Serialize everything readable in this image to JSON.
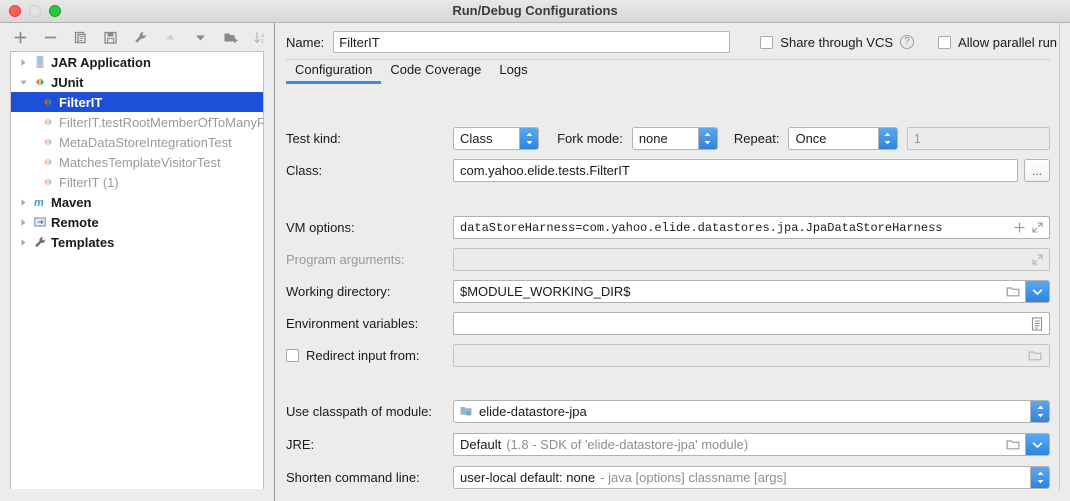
{
  "window": {
    "title": "Run/Debug Configurations"
  },
  "toolbar": {
    "buttons": [
      {
        "name": "add-configuration-button",
        "icon": "plus-icon",
        "enabled": true
      },
      {
        "name": "remove-configuration-button",
        "icon": "minus-icon",
        "enabled": true
      },
      {
        "name": "copy-configuration-button",
        "icon": "copy-icon",
        "enabled": true
      },
      {
        "name": "save-configuration-button",
        "icon": "save-icon",
        "enabled": true
      },
      {
        "name": "edit-templates-button",
        "icon": "wrench-icon",
        "enabled": true
      },
      {
        "name": "move-up-button",
        "icon": "arrow-up-icon",
        "enabled": false
      },
      {
        "name": "move-down-button",
        "icon": "arrow-down-icon",
        "enabled": true
      },
      {
        "name": "create-folder-button",
        "icon": "folder-add-icon",
        "enabled": true
      },
      {
        "name": "sort-configurations-button",
        "icon": "sort-az-icon",
        "enabled": true
      }
    ]
  },
  "tree": {
    "nodes": [
      {
        "label": "JAR Application",
        "depth": 1,
        "twisty": "collapsed",
        "icon": "jar-icon",
        "bold": true,
        "selected": false,
        "dim": false
      },
      {
        "label": "JUnit",
        "depth": 1,
        "twisty": "expanded",
        "icon": "junit-icon",
        "bold": true,
        "selected": false,
        "dim": false
      },
      {
        "label": "FilterIT",
        "depth": 2,
        "twisty": "none",
        "icon": "junit-icon",
        "bold": true,
        "selected": true,
        "dim": false
      },
      {
        "label": "FilterIT.testRootMemberOfToManyR",
        "depth": 2,
        "twisty": "none",
        "icon": "junit-icon",
        "bold": false,
        "selected": false,
        "dim": true
      },
      {
        "label": "MetaDataStoreIntegrationTest",
        "depth": 2,
        "twisty": "none",
        "icon": "junit-icon",
        "bold": false,
        "selected": false,
        "dim": true
      },
      {
        "label": "MatchesTemplateVisitorTest",
        "depth": 2,
        "twisty": "none",
        "icon": "junit-icon",
        "bold": false,
        "selected": false,
        "dim": true
      },
      {
        "label": "FilterIT (1)",
        "depth": 2,
        "twisty": "none",
        "icon": "junit-icon",
        "bold": false,
        "selected": false,
        "dim": true
      },
      {
        "label": "Maven",
        "depth": 1,
        "twisty": "collapsed",
        "icon": "maven-icon",
        "bold": true,
        "selected": false,
        "dim": false
      },
      {
        "label": "Remote",
        "depth": 1,
        "twisty": "collapsed",
        "icon": "remote-icon",
        "bold": true,
        "selected": false,
        "dim": false
      },
      {
        "label": "Templates",
        "depth": 1,
        "twisty": "collapsed",
        "icon": "wrench-icon",
        "bold": true,
        "selected": false,
        "dim": false
      }
    ]
  },
  "header": {
    "name_label": "Name:",
    "name_value": "FilterIT",
    "share_vcs_label": "Share through VCS",
    "share_vcs_checked": false,
    "help_glyph": "?",
    "allow_parallel_label": "Allow parallel run",
    "allow_parallel_checked": false
  },
  "tabs": [
    {
      "label": "Configuration",
      "active": true
    },
    {
      "label": "Code Coverage",
      "active": false
    },
    {
      "label": "Logs",
      "active": false
    }
  ],
  "form": {
    "test_kind_label": "Test kind:",
    "test_kind_value": "Class",
    "fork_mode_label": "Fork mode:",
    "fork_mode_value": "none",
    "repeat_label": "Repeat:",
    "repeat_value": "Once",
    "repeat_count_value": "1",
    "class_label": "Class:",
    "class_value": "com.yahoo.elide.tests.FilterIT",
    "class_browse_label": "...",
    "vm_options_label": "VM options:",
    "vm_options_value": "dataStoreHarness=com.yahoo.elide.datastores.jpa.JpaDataStoreHarness",
    "program_arguments_label": "Program arguments:",
    "program_arguments_value": "",
    "working_directory_label": "Working directory:",
    "working_directory_value": "$MODULE_WORKING_DIR$",
    "environment_variables_label": "Environment variables:",
    "environment_variables_value": "",
    "redirect_input_label": "Redirect input from:",
    "redirect_input_checked": false,
    "redirect_input_value": "",
    "classpath_module_label": "Use classpath of module:",
    "classpath_module_value": "elide-datastore-jpa",
    "jre_label": "JRE:",
    "jre_value": "Default",
    "jre_value_hint": "(1.8 - SDK of 'elide-datastore-jpa' module)",
    "shorten_label": "Shorten command line:",
    "shorten_value": "user-local default: none",
    "shorten_value_hint": "- java [options] classname [args]"
  },
  "colors": {
    "selection_blue": "#1d4fd8",
    "tab_underline": "#3a8ddc",
    "stepper_blue": "#2f83e0",
    "window_bg": "#ececec"
  }
}
